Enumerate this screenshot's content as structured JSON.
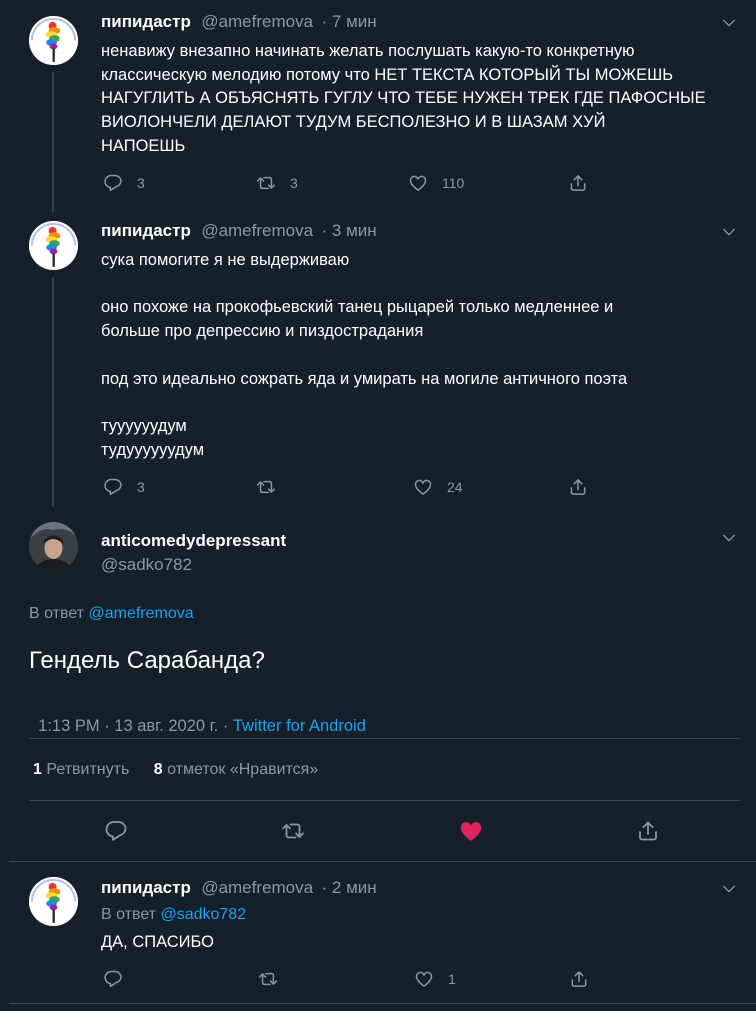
{
  "colors": {
    "background": "#15202b",
    "text": "#ffffff",
    "muted": "#8899a6",
    "link": "#1da1f2",
    "like_active": "#e0245e",
    "divider": "#38444d"
  },
  "tweets": [
    {
      "name": "пипидастр",
      "handle": "@amefremova",
      "time": "· 7 мин",
      "text": "ненавижу внезапно начинать желать послушать какую-то конкретную\nклассическую мелодию потому что НЕТ ТЕКСТА КОТОРЫЙ ТЫ МОЖЕШЬ\nНАГУГЛИТЬ А ОБЪЯСНЯТЬ ГУГЛУ ЧТО ТЕБЕ НУЖЕН ТРЕК ГДЕ ПАФОСНЫЕ\nВИОЛОНЧЕЛИ ДЕЛАЮТ ТУДУМ БЕСПОЛЕЗНО И В ШАЗАМ ХУЙ\nНАПОЕШЬ",
      "replies": "3",
      "retweets": "3",
      "likes": "110"
    },
    {
      "name": "пипидастр",
      "handle": "@amefremova",
      "time": "· 3 мин",
      "text": "сука помогите я не выдерживаю\n\nоно похоже на прокофьевский танец рыцарей только медленнее и\nбольше про депрессию и пиздострадания\n\nпод это идеально сожрать яда и умирать на могиле античного поэта\n\nтуууууудум\nтудуууууудум",
      "replies": "3",
      "retweets": "",
      "likes": "24"
    }
  ],
  "main_tweet": {
    "name": "anticomedydepressant",
    "handle": "@sadko782",
    "reply_prefix": "В ответ",
    "reply_to": "@amefremova",
    "text": "Гендель Сарабанда?",
    "timestamp": "1:13 PM · 13 авг. 2020 г. · ",
    "source": "Twitter for Android",
    "retweet_count": "1",
    "retweet_label": "Ретвитнуть",
    "like_count": "8",
    "like_label": "отметок «Нравится»"
  },
  "reply_tweet": {
    "name": "пипидастр",
    "handle": "@amefremova",
    "time": "· 2 мин",
    "reply_prefix": "В ответ",
    "reply_to": "@sadko782",
    "text": "ДА, СПАСИБО",
    "replies": "",
    "retweets": "",
    "likes": "1"
  },
  "icons": [
    "reply-icon",
    "retweet-icon",
    "like-icon",
    "share-icon",
    "chevron-down-icon",
    "feather-duster-avatar",
    "user-photo-avatar"
  ]
}
